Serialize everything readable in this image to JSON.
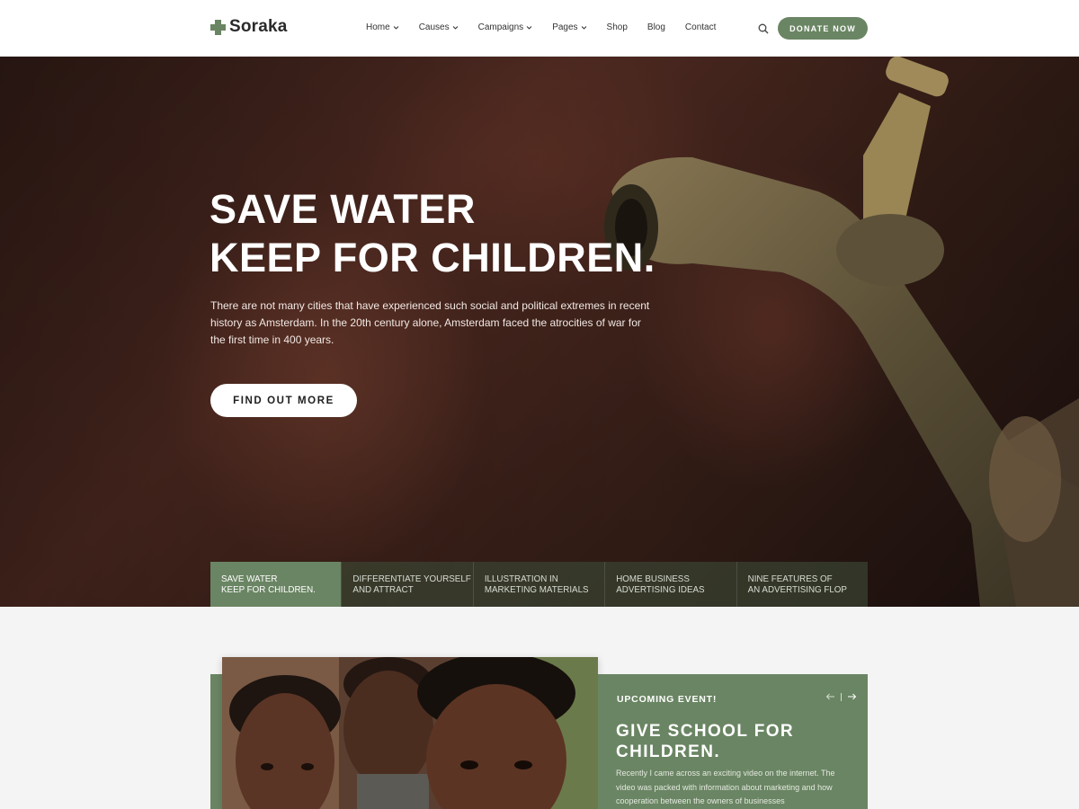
{
  "brand": {
    "name": "Soraka",
    "accent": "#6a8563"
  },
  "nav": {
    "items": [
      {
        "label": "Home",
        "has_dropdown": true
      },
      {
        "label": "Causes",
        "has_dropdown": true
      },
      {
        "label": "Campaigns",
        "has_dropdown": true
      },
      {
        "label": "Pages",
        "has_dropdown": true
      },
      {
        "label": "Shop",
        "has_dropdown": false
      },
      {
        "label": "Blog",
        "has_dropdown": false
      },
      {
        "label": "Contact",
        "has_dropdown": false
      }
    ],
    "search_icon": "search-icon",
    "donate_label": "DONATE NOW"
  },
  "hero": {
    "title_line1": "SAVE WATER",
    "title_line2": "KEEP FOR CHILDREN.",
    "text": "There are not many cities that have experienced such social and political extremes in recent history as Amsterdam. In the 20th century alone, Amsterdam faced the atrocities of war for the first time in 400 years.",
    "cta_label": "FIND OUT MORE",
    "tabs": [
      {
        "line1": "Save water",
        "line2": "Keep for children.",
        "active": true
      },
      {
        "line1": "Differentiate yourself",
        "line2": "and attract",
        "active": false
      },
      {
        "line1": "Illustration in",
        "line2": "marketing materials",
        "active": false
      },
      {
        "line1": "Home business",
        "line2": "advertising ideas",
        "active": false
      },
      {
        "line1": "Nine features of",
        "line2": "an advertising flop",
        "active": false
      }
    ]
  },
  "event": {
    "label": "UPCOMING EVENT!",
    "title_line1": "GIVE SCHOOL FOR",
    "title_line2": "CHILDREN.",
    "text": "Recently I came across an exciting video on the internet. The video was packed with information about marketing and how cooperation between the owners of businesses",
    "prev_icon": "arrow-left-icon",
    "next_icon": "arrow-right-icon"
  }
}
